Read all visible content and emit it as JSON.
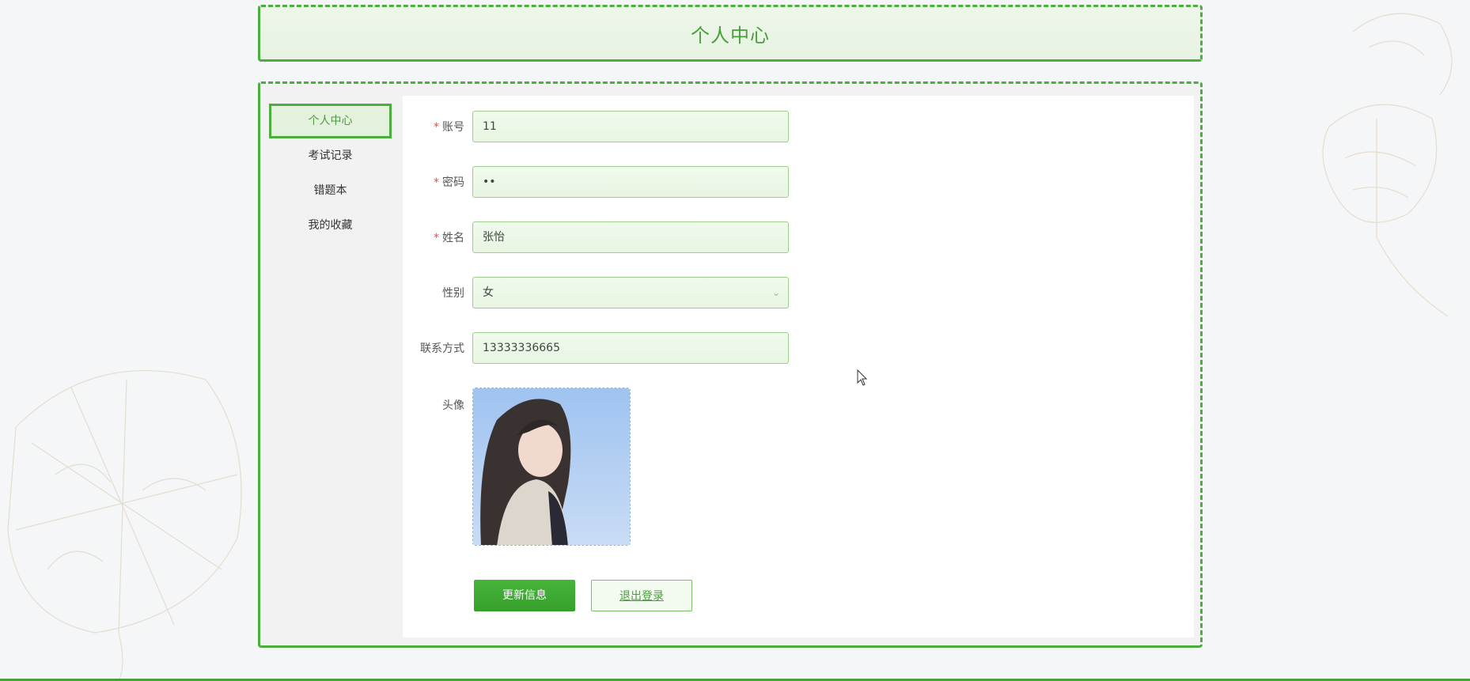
{
  "page": {
    "title": "个人中心"
  },
  "sidebar": {
    "items": [
      {
        "label": "个人中心",
        "active": true
      },
      {
        "label": "考试记录",
        "active": false
      },
      {
        "label": "错题本",
        "active": false
      },
      {
        "label": "我的收藏",
        "active": false
      }
    ]
  },
  "form": {
    "account": {
      "label": "账号",
      "required": true,
      "value": "11"
    },
    "password": {
      "label": "密码",
      "required": true,
      "value": "••"
    },
    "name": {
      "label": "姓名",
      "required": true,
      "value": "张怡"
    },
    "gender": {
      "label": "性别",
      "required": false,
      "value": "女"
    },
    "phone": {
      "label": "联系方式",
      "required": false,
      "value": "13333336665"
    },
    "avatar": {
      "label": "头像"
    }
  },
  "buttons": {
    "update": "更新信息",
    "logout": "退出登录"
  },
  "colors": {
    "accent": "#4cae3f",
    "required_mark": "#e64e4e"
  }
}
